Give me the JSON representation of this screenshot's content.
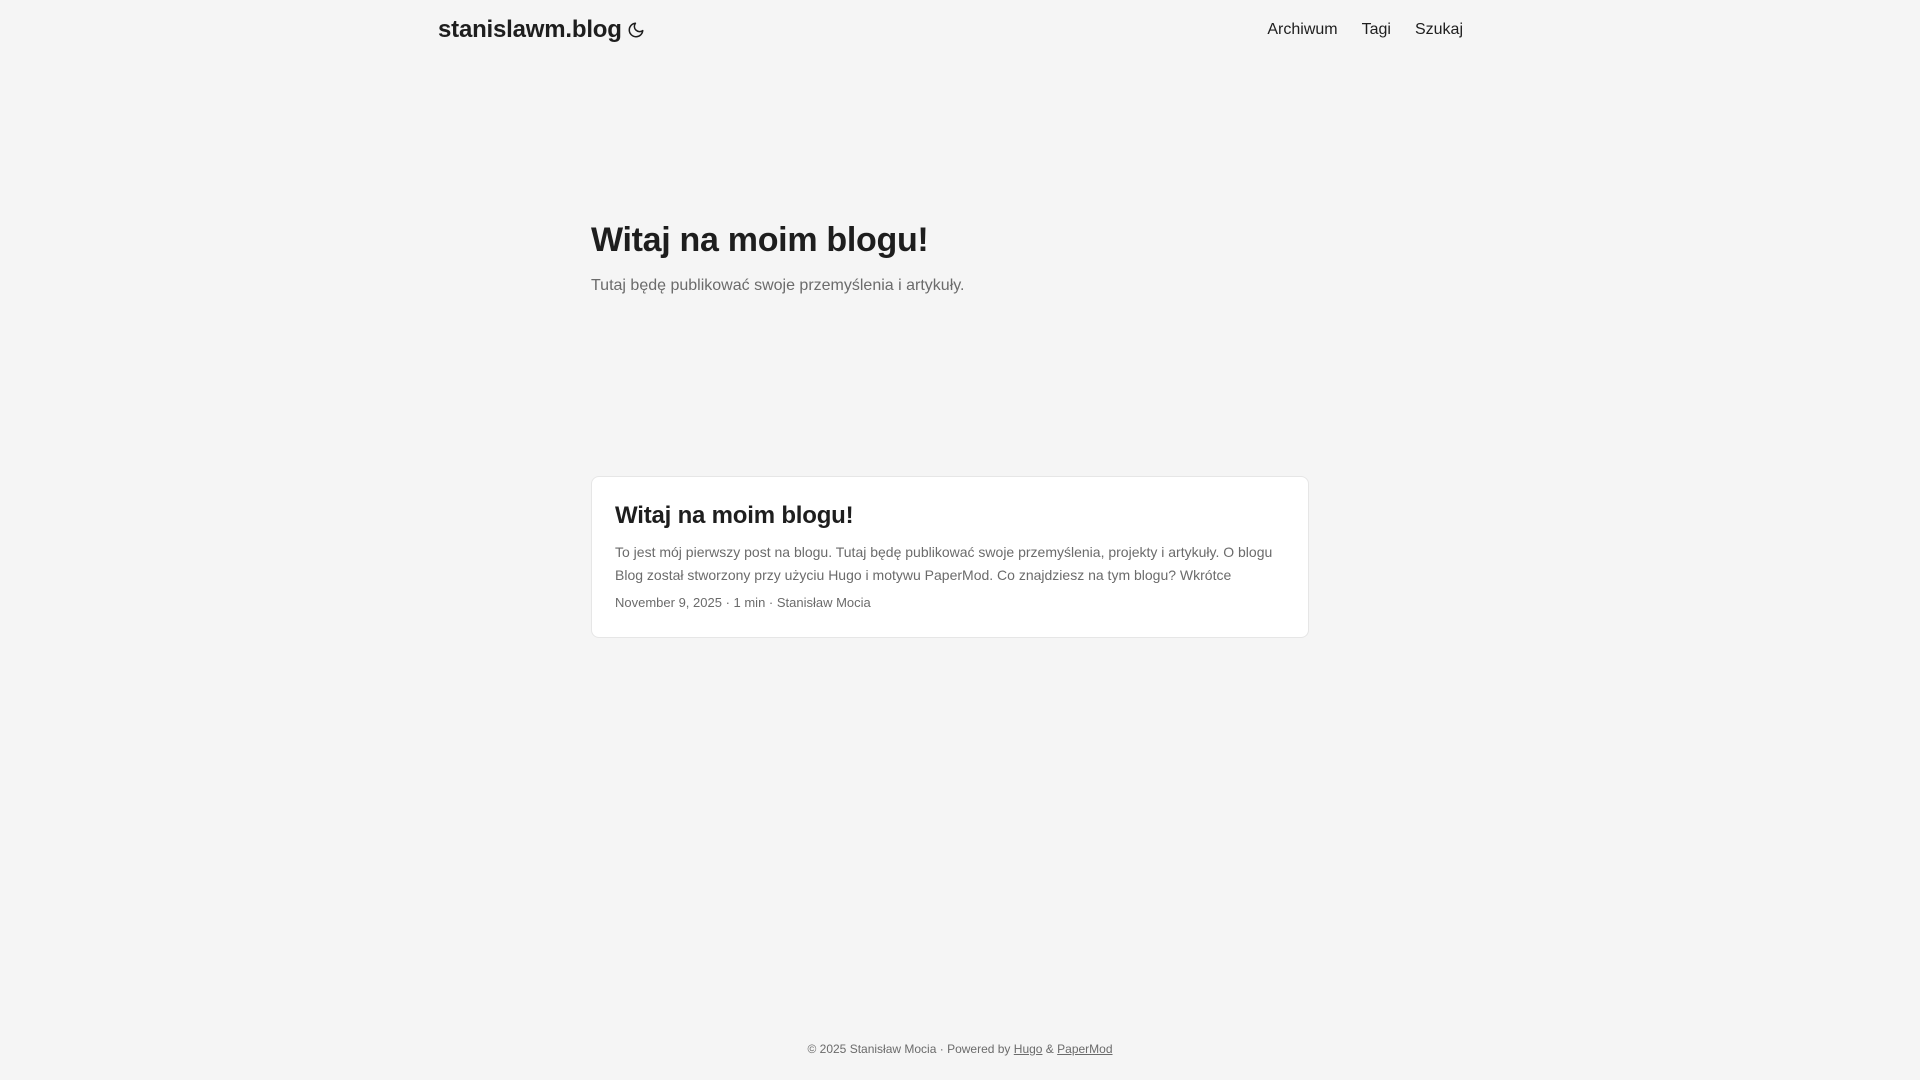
{
  "header": {
    "logo": "stanislawm.blog",
    "theme_icon": "moon-icon",
    "menu": [
      {
        "label": "Archiwum"
      },
      {
        "label": "Tagi"
      },
      {
        "label": "Szukaj"
      }
    ]
  },
  "home_info": {
    "title": "Witaj na moim blogu!",
    "subtitle": "Tutaj będę publikować swoje przemyślenia i artykuły."
  },
  "posts": [
    {
      "title": "Witaj na moim blogu!",
      "summary": "To jest mój pierwszy post na blogu. Tutaj będę publikować swoje przemyślenia, projekty i artykuły. O blogu Blog został stworzony przy użyciu Hugo i motywu PaperMod. Co znajdziesz na tym blogu? Wkrótce pojawi...",
      "meta": "November 9, 2025 · 1 min · Stanisław Mocia"
    }
  ],
  "footer": {
    "copyright": "© 2025 Stanisław Mocia",
    "separator": " · ",
    "powered_by": "Powered by",
    "hugo_link": "Hugo",
    "amp": " & ",
    "papermod_link": "PaperMod"
  },
  "colors": {
    "background": "#f5f5f5",
    "text": "#1e1e1e",
    "secondary": "#6b6b6b",
    "card": "#ffffff"
  }
}
